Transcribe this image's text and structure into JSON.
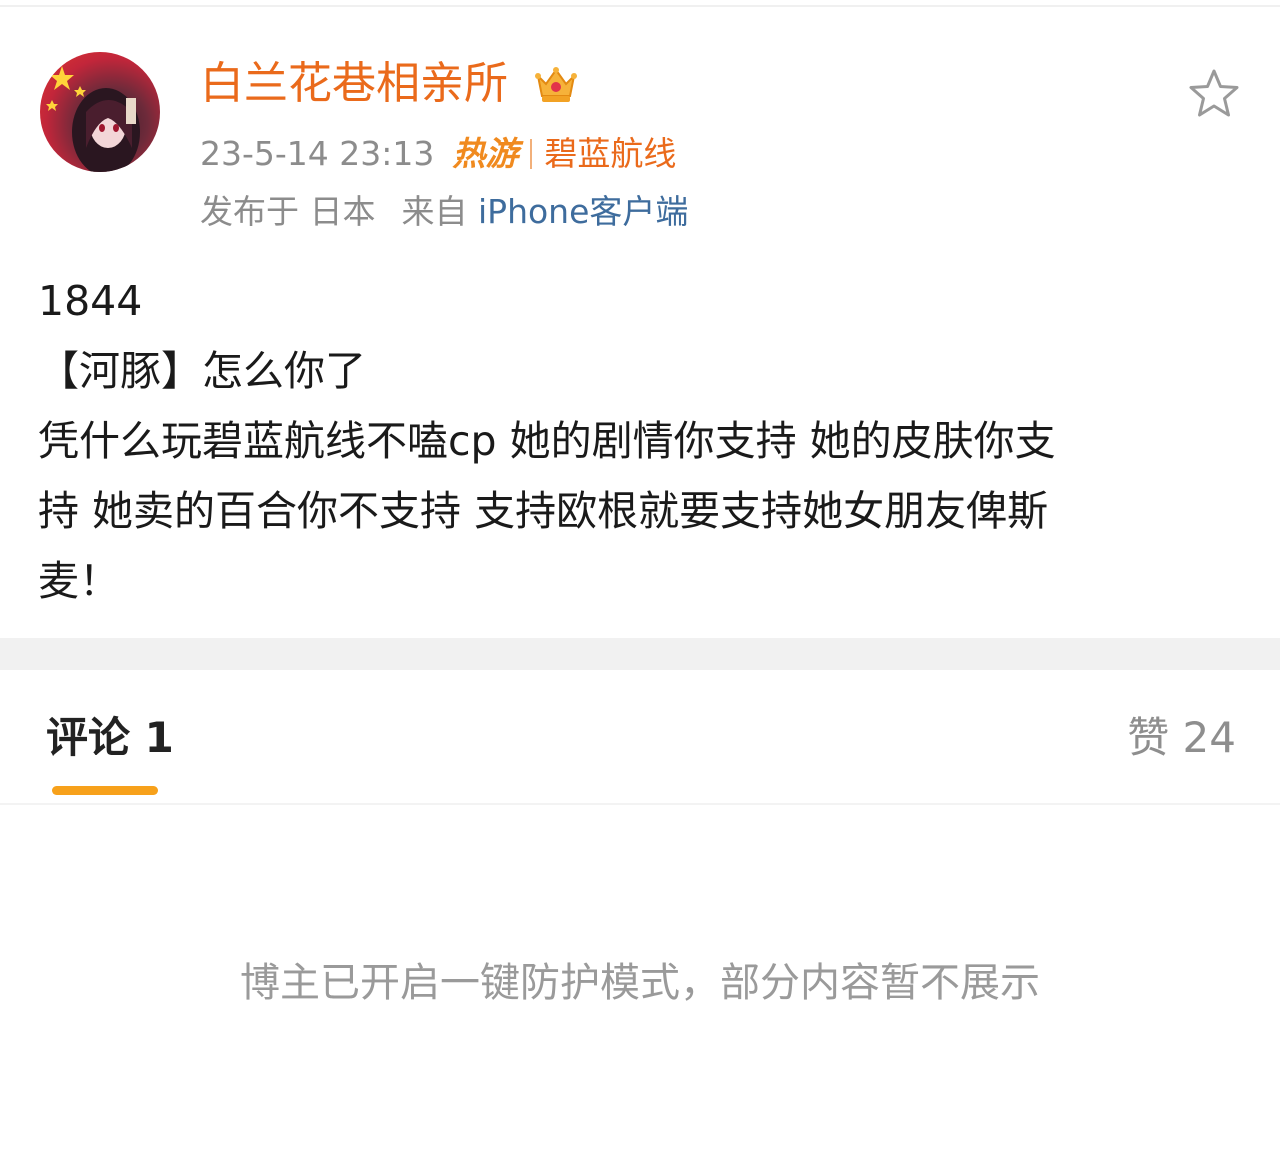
{
  "post": {
    "username": "白兰花巷相亲所",
    "timestamp": "23-5-14 23:13",
    "hot_badge": "热游",
    "topic": "碧蓝航线",
    "location": "发布于 日本",
    "source_prefix": "来自",
    "device": "iPhone客户端",
    "body_lines": [
      "1844",
      "【河豚】怎么你了",
      "凭什么玩碧蓝航线不嗑cp 她的剧情你支持 她的皮肤你支",
      "持 她卖的百合你不支持 支持欧根就要支持她女朋友俾斯",
      "麦！"
    ],
    "icons": {
      "avatar": "avatar",
      "crown": "crown-icon",
      "favorite": "star-icon"
    },
    "colors": {
      "username": "#ea6a1b",
      "device_link": "#3e6c9d",
      "accent_underline": "#f7a11b"
    }
  },
  "tabs": {
    "comments_label": "评论 1",
    "likes_label": "赞 24"
  },
  "comments": {
    "notice": "博主已开启一键防护模式，部分内容暂不展示"
  }
}
